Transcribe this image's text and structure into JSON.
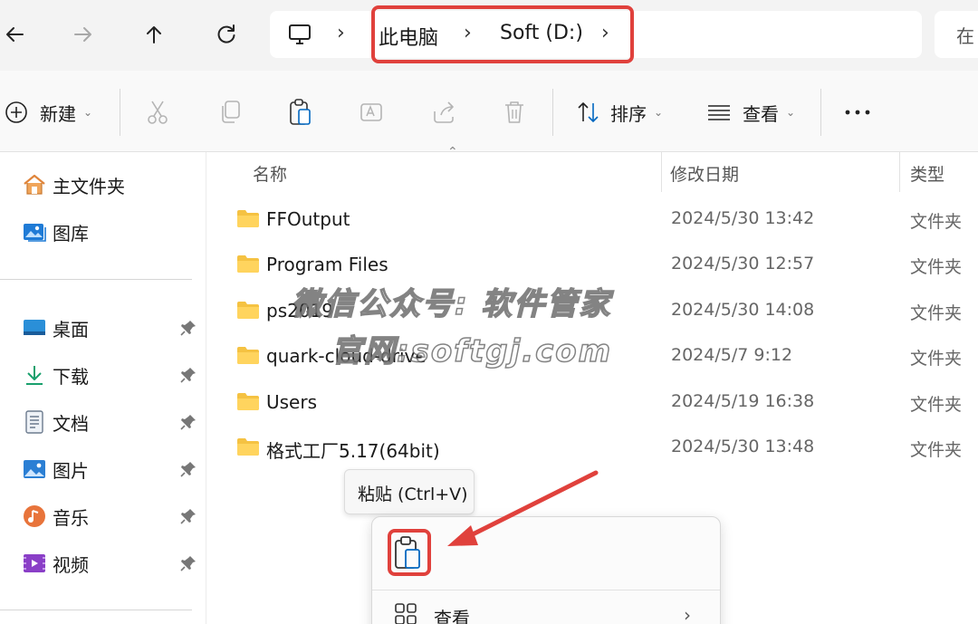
{
  "address_bar": {
    "breadcrumbs": [
      "此电脑",
      "Soft (D:)"
    ],
    "search_placeholder": "在"
  },
  "toolbar": {
    "new_label": "新建",
    "sort_label": "排序",
    "view_label": "查看"
  },
  "sidebar": {
    "quick": [
      {
        "label": "主文件夹",
        "icon": "home-icon"
      },
      {
        "label": "图库",
        "icon": "gallery-icon"
      }
    ],
    "pinned": [
      {
        "label": "桌面",
        "icon": "desktop-icon"
      },
      {
        "label": "下载",
        "icon": "download-icon"
      },
      {
        "label": "文档",
        "icon": "document-icon"
      },
      {
        "label": "图片",
        "icon": "pictures-icon"
      },
      {
        "label": "音乐",
        "icon": "music-icon"
      },
      {
        "label": "视频",
        "icon": "video-icon"
      }
    ]
  },
  "columns": {
    "name": "名称",
    "modified": "修改日期",
    "type": "类型"
  },
  "files": [
    {
      "name": "FFOutput",
      "modified": "2024/5/30 13:42",
      "type": "文件夹"
    },
    {
      "name": "Program Files",
      "modified": "2024/5/30 12:57",
      "type": "文件夹"
    },
    {
      "name": "ps2019",
      "modified": "2024/5/30 14:08",
      "type": "文件夹"
    },
    {
      "name": "quark-cloud-drive",
      "modified": "2024/5/7 9:12",
      "type": "文件夹"
    },
    {
      "name": "Users",
      "modified": "2024/5/19 16:38",
      "type": "文件夹"
    },
    {
      "name": "格式工厂5.17(64bit)",
      "modified": "2024/5/30 13:48",
      "type": "文件夹"
    }
  ],
  "watermark": {
    "line1": "微信公众号: 软件管家",
    "line2": "官网:softgj.com"
  },
  "tooltip": {
    "text": "粘贴 (Ctrl+V)"
  },
  "context_menu": {
    "view_label": "查看"
  },
  "colors": {
    "highlight": "#e0413c",
    "folder": "#f5c242",
    "accent": "#0067c0"
  }
}
